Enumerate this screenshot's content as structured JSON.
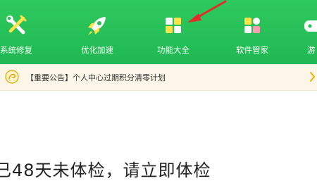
{
  "toolbar": {
    "tools": [
      {
        "label": "系统修复",
        "icon": "wrench-screwdriver-icon"
      },
      {
        "label": "优化加速",
        "icon": "rocket-icon"
      },
      {
        "label": "功能大全",
        "icon": "app-grid-icon"
      },
      {
        "label": "软件管家",
        "icon": "software-blocks-icon"
      },
      {
        "label": "游",
        "icon": "game-icon"
      }
    ]
  },
  "notice": {
    "icon": "notice-swirl-icon",
    "tag": "【重要公告】",
    "text": "个人中心过期积分清零计划"
  },
  "main": {
    "message": "已48天未体检，请立即体检"
  },
  "colors": {
    "toolbar_green": "#22bd55",
    "arrow_red": "#e52a2a",
    "notice_bg": "#fbf6e8"
  }
}
